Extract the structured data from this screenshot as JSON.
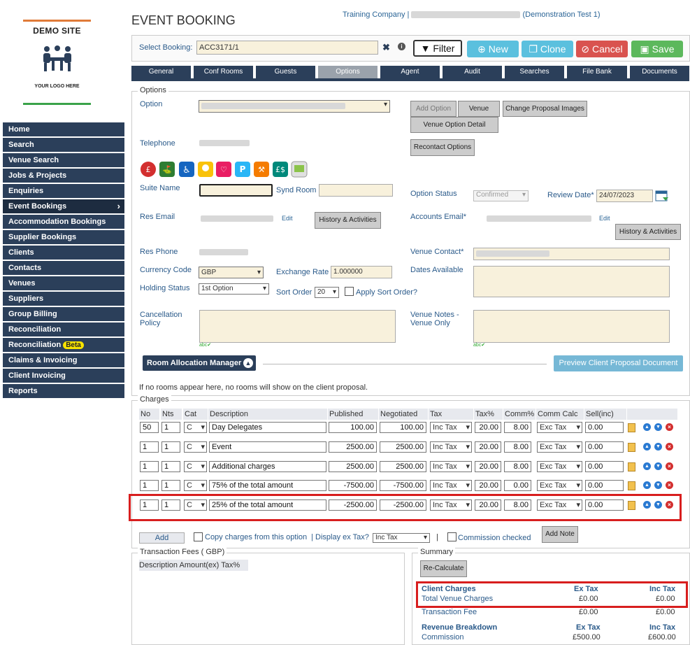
{
  "logo": {
    "title": "DEMO SITE",
    "subtitle": "YOUR LOGO HERE"
  },
  "nav": [
    {
      "label": "Home"
    },
    {
      "label": "Search"
    },
    {
      "label": "Venue Search"
    },
    {
      "label": "Jobs & Projects"
    },
    {
      "label": "Enquiries"
    },
    {
      "label": "Event Bookings",
      "active": true
    },
    {
      "label": "Accommodation Bookings"
    },
    {
      "label": "Supplier Bookings"
    },
    {
      "label": "Clients"
    },
    {
      "label": "Contacts"
    },
    {
      "label": "Venues"
    },
    {
      "label": "Suppliers"
    },
    {
      "label": "Group Billing"
    },
    {
      "label": "Reconciliation"
    },
    {
      "label": "Reconciliation",
      "badge": "Beta"
    },
    {
      "label": "Claims & Invoicing"
    },
    {
      "label": "Client Invoicing"
    },
    {
      "label": "Reports"
    }
  ],
  "header": {
    "title": "EVENT BOOKING",
    "company_prefix": "Training Company |",
    "company_suffix": "(Demonstration Test 1)"
  },
  "toolbar": {
    "select_label": "Select Booking:",
    "booking_value": "ACC3171/1",
    "filter": "Filter",
    "new": "New",
    "clone": "Clone",
    "cancel": "Cancel",
    "save": "Save"
  },
  "tabs": [
    "General",
    "Conf Rooms",
    "Guests",
    "Options",
    "Agent",
    "Audit",
    "Searches",
    "File Bank",
    "Documents"
  ],
  "options": {
    "legend": "Options",
    "option_label": "Option",
    "telephone_label": "Telephone",
    "add_option": "Add Option",
    "venue": "Venue",
    "change_images": "Change Proposal Images",
    "venue_option_detail": "Venue Option Detail",
    "recontact": "Recontact Options",
    "suite_name_label": "Suite Name",
    "synd_room_label": "Synd Room",
    "option_status_label": "Option Status",
    "option_status_value": "Confirmed",
    "review_date_label": "Review Date*",
    "review_date_value": "24/07/2023",
    "res_email_label": "Res Email",
    "edit": "Edit",
    "history": "History & Activities",
    "accounts_email_label": "Accounts Email*",
    "res_phone_label": "Res Phone",
    "venue_contact_label": "Venue Contact*",
    "currency_label": "Currency Code",
    "currency_value": "GBP",
    "exchange_label": "Exchange Rate",
    "exchange_value": "1.000000",
    "dates_label": "Dates Available",
    "holding_label": "Holding Status",
    "holding_value": "1st Option",
    "sort_label": "Sort Order",
    "sort_value": "20",
    "apply_sort": "Apply Sort Order?",
    "cancel_policy_label_1": "Cancellation",
    "cancel_policy_label_2": "Policy",
    "venue_notes_label_1": "Venue Notes -",
    "venue_notes_label_2": "Venue Only",
    "room_alloc": "Room Allocation Manager",
    "preview": "Preview Client Proposal Document",
    "no_rooms": "If no rooms appear here, no rooms will show on the client proposal."
  },
  "charges": {
    "legend": "Charges",
    "headers": [
      "No",
      "Nts",
      "Cat",
      "Description",
      "Published",
      "Negotiated",
      "Tax",
      "Tax%",
      "Comm%",
      "Comm Calc",
      "Sell(inc)"
    ],
    "rows": [
      {
        "no": "50",
        "nts": "1",
        "cat": "C",
        "desc": "Day Delegates",
        "pub": "100.00",
        "neg": "100.00",
        "tax": "Inc Tax",
        "taxp": "20.00",
        "comm": "8.00",
        "calc": "Exc Tax",
        "sell": "0.00"
      },
      {
        "no": "1",
        "nts": "1",
        "cat": "C",
        "desc": "Event",
        "pub": "2500.00",
        "neg": "2500.00",
        "tax": "Inc Tax",
        "taxp": "20.00",
        "comm": "8.00",
        "calc": "Exc Tax",
        "sell": "0.00"
      },
      {
        "no": "1",
        "nts": "1",
        "cat": "C",
        "desc": "Additional charges",
        "pub": "2500.00",
        "neg": "2500.00",
        "tax": "Inc Tax",
        "taxp": "20.00",
        "comm": "8.00",
        "calc": "Exc Tax",
        "sell": "0.00"
      },
      {
        "no": "1",
        "nts": "1",
        "cat": "C",
        "desc": "75% of the total amount",
        "pub": "-7500.00",
        "neg": "-7500.00",
        "tax": "Inc Tax",
        "taxp": "20.00",
        "comm": "0.00",
        "calc": "Exc Tax",
        "sell": "0.00"
      },
      {
        "no": "1",
        "nts": "1",
        "cat": "C",
        "desc": "25% of the total amount",
        "pub": "-2500.00",
        "neg": "-2500.00",
        "tax": "Inc Tax",
        "taxp": "20.00",
        "comm": "8.00",
        "calc": "Exc Tax",
        "sell": "0.00"
      }
    ],
    "add": "Add",
    "copy_charges": "Copy charges from this option",
    "display_ex_tax": "Display ex Tax?",
    "display_value": "Inc Tax",
    "commission_checked": "Commission checked",
    "add_note": "Add Note"
  },
  "transaction": {
    "legend": "Transaction Fees ( GBP)",
    "headers": [
      "Description",
      "Amount(ex)",
      "Tax%"
    ]
  },
  "summary": {
    "legend": "Summary",
    "recalc": "Re-Calculate",
    "client_charges": "Client Charges",
    "ex_tax": "Ex Tax",
    "inc_tax": "Inc Tax",
    "total_venue": "Total Venue Charges",
    "total_ex": "£0.00",
    "total_inc": "£0.00",
    "transaction_fee": "Transaction Fee",
    "tf_ex": "£0.00",
    "tf_inc": "£0.00",
    "revenue": "Revenue Breakdown",
    "commission": "Commission",
    "comm_ex": "£500.00",
    "comm_inc": "£600.00"
  }
}
